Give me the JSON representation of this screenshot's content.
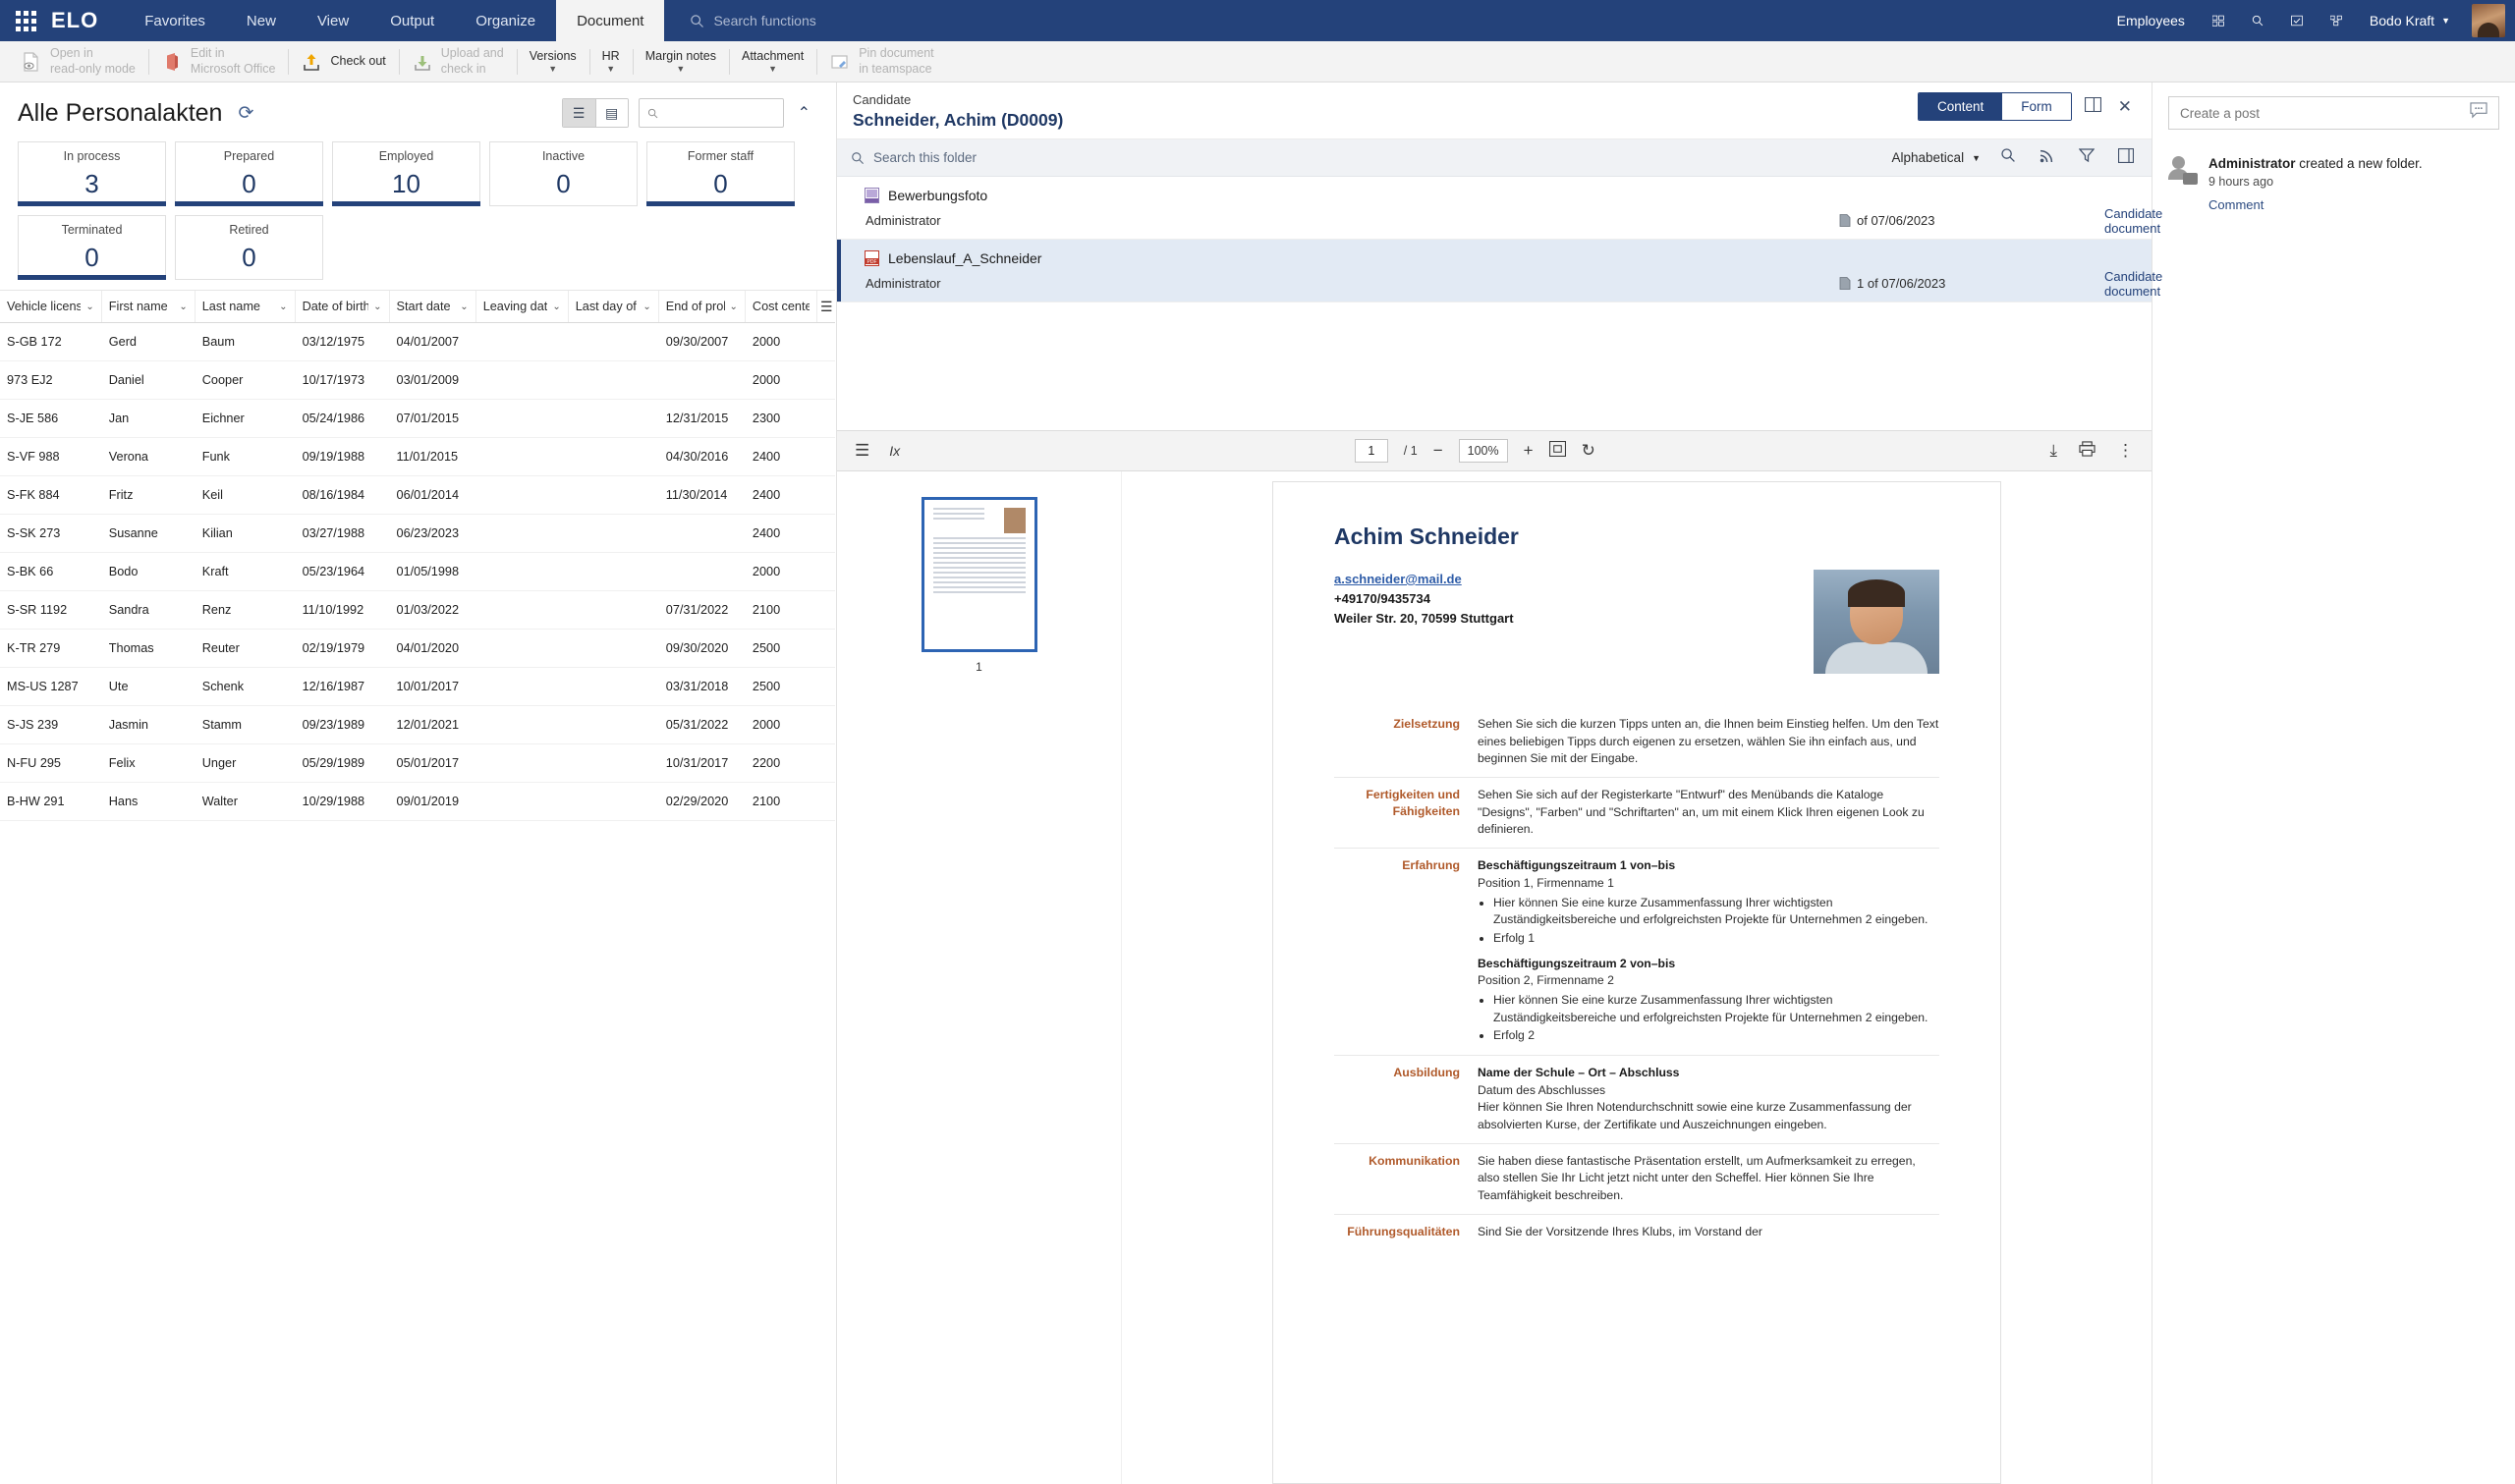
{
  "topnav": {
    "brand": "ELO",
    "tabs": [
      {
        "label": "Favorites",
        "active": false
      },
      {
        "label": "New",
        "active": false
      },
      {
        "label": "View",
        "active": false
      },
      {
        "label": "Output",
        "active": false
      },
      {
        "label": "Organize",
        "active": false
      },
      {
        "label": "Document",
        "active": true
      }
    ],
    "search_placeholder": "Search functions",
    "right": {
      "employees": "Employees",
      "user": "Bodo Kraft"
    }
  },
  "ribbon": {
    "items": [
      {
        "label_line1": "Open in",
        "label_line2": "read-only mode",
        "icon": "document-eye-icon",
        "disabled": true,
        "caret": false
      },
      {
        "label_line1": "Edit in",
        "label_line2": "Microsoft Office",
        "icon": "office-icon",
        "disabled": true,
        "caret": false
      },
      {
        "label_line1": "Check out",
        "label_line2": "",
        "icon": "upload-arrow-icon",
        "disabled": false,
        "caret": false
      },
      {
        "label_line1": "Upload and",
        "label_line2": "check in",
        "icon": "download-arrow-icon",
        "disabled": true,
        "caret": false
      },
      {
        "label_line1": "Versions",
        "label_line2": "",
        "icon": "",
        "disabled": false,
        "caret": true
      },
      {
        "label_line1": "HR",
        "label_line2": "",
        "icon": "",
        "disabled": false,
        "caret": true
      },
      {
        "label_line1": "Margin notes",
        "label_line2": "",
        "icon": "",
        "disabled": false,
        "caret": true
      },
      {
        "label_line1": "Attachment",
        "label_line2": "",
        "icon": "",
        "disabled": false,
        "caret": true
      },
      {
        "label_line1": "Pin document",
        "label_line2": "in teamspace",
        "icon": "pin-teamspace-icon",
        "disabled": true,
        "caret": false
      }
    ]
  },
  "left": {
    "title": "Alle Personalakten",
    "search_placeholder": "",
    "tiles": [
      {
        "label": "In process",
        "value": "3",
        "highlighted": true
      },
      {
        "label": "Prepared",
        "value": "0",
        "highlighted": true
      },
      {
        "label": "Employed",
        "value": "10",
        "highlighted": true
      },
      {
        "label": "Inactive",
        "value": "0",
        "highlighted": false
      },
      {
        "label": "Former staff",
        "value": "0",
        "highlighted": true
      },
      {
        "label": "Terminated",
        "value": "0",
        "highlighted": true
      },
      {
        "label": "Retired",
        "value": "0",
        "highlighted": false
      }
    ],
    "table": {
      "columns": [
        "Vehicle license ..",
        "First name",
        "Last name",
        "Date of birth ..",
        "Start date",
        "Leaving date..",
        "Last day of w..",
        "End of proba..",
        "Cost center"
      ],
      "rows": [
        [
          "S-GB 172",
          "Gerd",
          "Baum",
          "03/12/1975",
          "04/01/2007",
          "",
          "",
          "09/30/2007",
          "2000"
        ],
        [
          "973 EJ2",
          "Daniel",
          "Cooper",
          "10/17/1973",
          "03/01/2009",
          "",
          "",
          "",
          "2000"
        ],
        [
          "S-JE 586",
          "Jan",
          "Eichner",
          "05/24/1986",
          "07/01/2015",
          "",
          "",
          "12/31/2015",
          "2300"
        ],
        [
          "S-VF 988",
          "Verona",
          "Funk",
          "09/19/1988",
          "11/01/2015",
          "",
          "",
          "04/30/2016",
          "2400"
        ],
        [
          "S-FK 884",
          "Fritz",
          "Keil",
          "08/16/1984",
          "06/01/2014",
          "",
          "",
          "11/30/2014",
          "2400"
        ],
        [
          "S-SK 273",
          "Susanne",
          "Kilian",
          "03/27/1988",
          "06/23/2023",
          "",
          "",
          "",
          "2400"
        ],
        [
          "S-BK 66",
          "Bodo",
          "Kraft",
          "05/23/1964",
          "01/05/1998",
          "",
          "",
          "",
          "2000"
        ],
        [
          "S-SR 1192",
          "Sandra",
          "Renz",
          "11/10/1992",
          "01/03/2022",
          "",
          "",
          "07/31/2022",
          "2100"
        ],
        [
          "K-TR 279",
          "Thomas",
          "Reuter",
          "02/19/1979",
          "04/01/2020",
          "",
          "",
          "09/30/2020",
          "2500"
        ],
        [
          "MS-US 1287",
          "Ute",
          "Schenk",
          "12/16/1987",
          "10/01/2017",
          "",
          "",
          "03/31/2018",
          "2500"
        ],
        [
          "S-JS 239",
          "Jasmin",
          "Stamm",
          "09/23/1989",
          "12/01/2021",
          "",
          "",
          "05/31/2022",
          "2000"
        ],
        [
          "N-FU 295",
          "Felix",
          "Unger",
          "05/29/1989",
          "05/01/2017",
          "",
          "",
          "10/31/2017",
          "2200"
        ],
        [
          "B-HW 291",
          "Hans",
          "Walter",
          "10/29/1988",
          "09/01/2019",
          "",
          "",
          "02/29/2020",
          "2100"
        ]
      ]
    }
  },
  "candidate": {
    "subtitle": "Candidate",
    "title": "Schneider, Achim (D0009)",
    "view_buttons": [
      {
        "label": "Content",
        "active": true
      },
      {
        "label": "Form",
        "active": false
      }
    ],
    "folder_search_placeholder": "Search this folder",
    "sort_label": "Alphabetical",
    "documents": [
      {
        "name": "Bewerbungsfoto",
        "icon": "image-file-icon",
        "owner": "Administrator",
        "version": "of 07/06/2023",
        "type": "Candidate document",
        "selected": false
      },
      {
        "name": "Lebenslauf_A_Schneider",
        "icon": "pdf-file-icon",
        "owner": "Administrator",
        "version": "1 of 07/06/2023",
        "type": "Candidate document",
        "selected": true
      }
    ]
  },
  "viewer": {
    "page_current": "1",
    "page_total": "/ 1",
    "zoom": "100%",
    "thumb_page_number": "1"
  },
  "cv": {
    "name": "Achim Schneider",
    "email": "a.schneider@mail.de",
    "phone": "+49170/9435734",
    "address": "Weiler Str. 20, 70599 Stuttgart",
    "sections": [
      {
        "label": "Zielsetzung",
        "body": "Sehen Sie sich die kurzen Tipps unten an, die Ihnen beim Einstieg helfen. Um den Text eines beliebigen Tipps durch eigenen zu ersetzen, wählen Sie ihn einfach aus, und beginnen Sie mit der Eingabe."
      },
      {
        "label": "Fertigkeiten und Fähigkeiten",
        "body": "Sehen Sie sich auf der Registerkarte \"Entwurf\" des Menübands die Kataloge \"Designs\", \"Farben\" und \"Schriftarten\" an, um mit einem Klick Ihren eigenen Look zu definieren."
      },
      {
        "label": "Erfahrung",
        "blocks": [
          {
            "heading": "Beschäftigungszeitraum 1 von–bis",
            "sub": "Position 1, Firmenname 1",
            "bullets": [
              "Hier können Sie eine kurze Zusammenfassung Ihrer wichtigsten Zuständigkeitsbereiche und erfolgreichsten Projekte für Unternehmen 2 eingeben.",
              "Erfolg 1"
            ]
          },
          {
            "heading": "Beschäftigungszeitraum 2 von–bis",
            "sub": "Position 2, Firmenname 2",
            "bullets": [
              "Hier können Sie eine kurze Zusammenfassung Ihrer wichtigsten Zuständigkeitsbereiche und erfolgreichsten Projekte für Unternehmen 2 eingeben.",
              "Erfolg 2"
            ]
          }
        ]
      },
      {
        "label": "Ausbildung",
        "heading": "Name der Schule – Ort – Abschluss",
        "body": "Datum des Abschlusses\nHier können Sie Ihren Notendurchschnitt sowie eine kurze Zusammenfassung der absolvierten Kurse, der Zertifikate und Auszeichnungen eingeben."
      },
      {
        "label": "Kommunikation",
        "body": "Sie haben diese fantastische Präsentation erstellt, um Aufmerksamkeit zu erregen, also stellen Sie Ihr Licht jetzt nicht unter den Scheffel. Hier können Sie Ihre Teamfähigkeit beschreiben."
      },
      {
        "label": "Führungsqualitäten",
        "body": "Sind Sie der Vorsitzende Ihres Klubs, im Vorstand der"
      }
    ]
  },
  "feed": {
    "post_placeholder": "Create a post",
    "items": [
      {
        "author": "Administrator",
        "action": "created a new folder.",
        "time": "9 hours ago",
        "comment_label": "Comment"
      }
    ]
  },
  "colors": {
    "navy": "#24427a",
    "accent_orange": "#b05a2b",
    "value_blue": "#1f3864"
  }
}
